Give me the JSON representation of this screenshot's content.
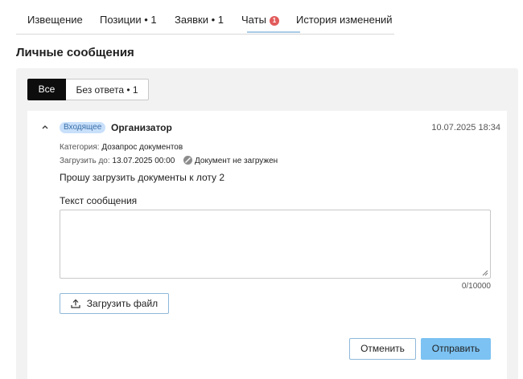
{
  "tabs": [
    {
      "label": "Извещение"
    },
    {
      "label": "Позиции • 1"
    },
    {
      "label": "Заявки • 1"
    },
    {
      "label": "Чаты",
      "badge": "1"
    },
    {
      "label": "История изменений"
    }
  ],
  "section_title": "Личные сообщения",
  "filters": {
    "all": "Все",
    "unanswered": "Без ответа • 1"
  },
  "message": {
    "tag": "Входящее",
    "sender": "Организатор",
    "date": "10.07.2025 18:34",
    "category_label": "Категория:",
    "category_value": "Дозапрос документов",
    "deadline_label": "Загрузить до:",
    "deadline_value": "13.07.2025 00:00",
    "doc_status": "Документ не загружен",
    "body": "Прошу загрузить документы к лоту 2"
  },
  "reply": {
    "label": "Текст сообщения",
    "value": "",
    "counter": "0/10000",
    "upload_label": "Загрузить файл",
    "cancel_label": "Отменить",
    "send_label": "Отправить"
  },
  "colors": {
    "accent": "#7cc2f2",
    "badge": "#e25b5b",
    "tag_bg": "#c9e0fa"
  }
}
